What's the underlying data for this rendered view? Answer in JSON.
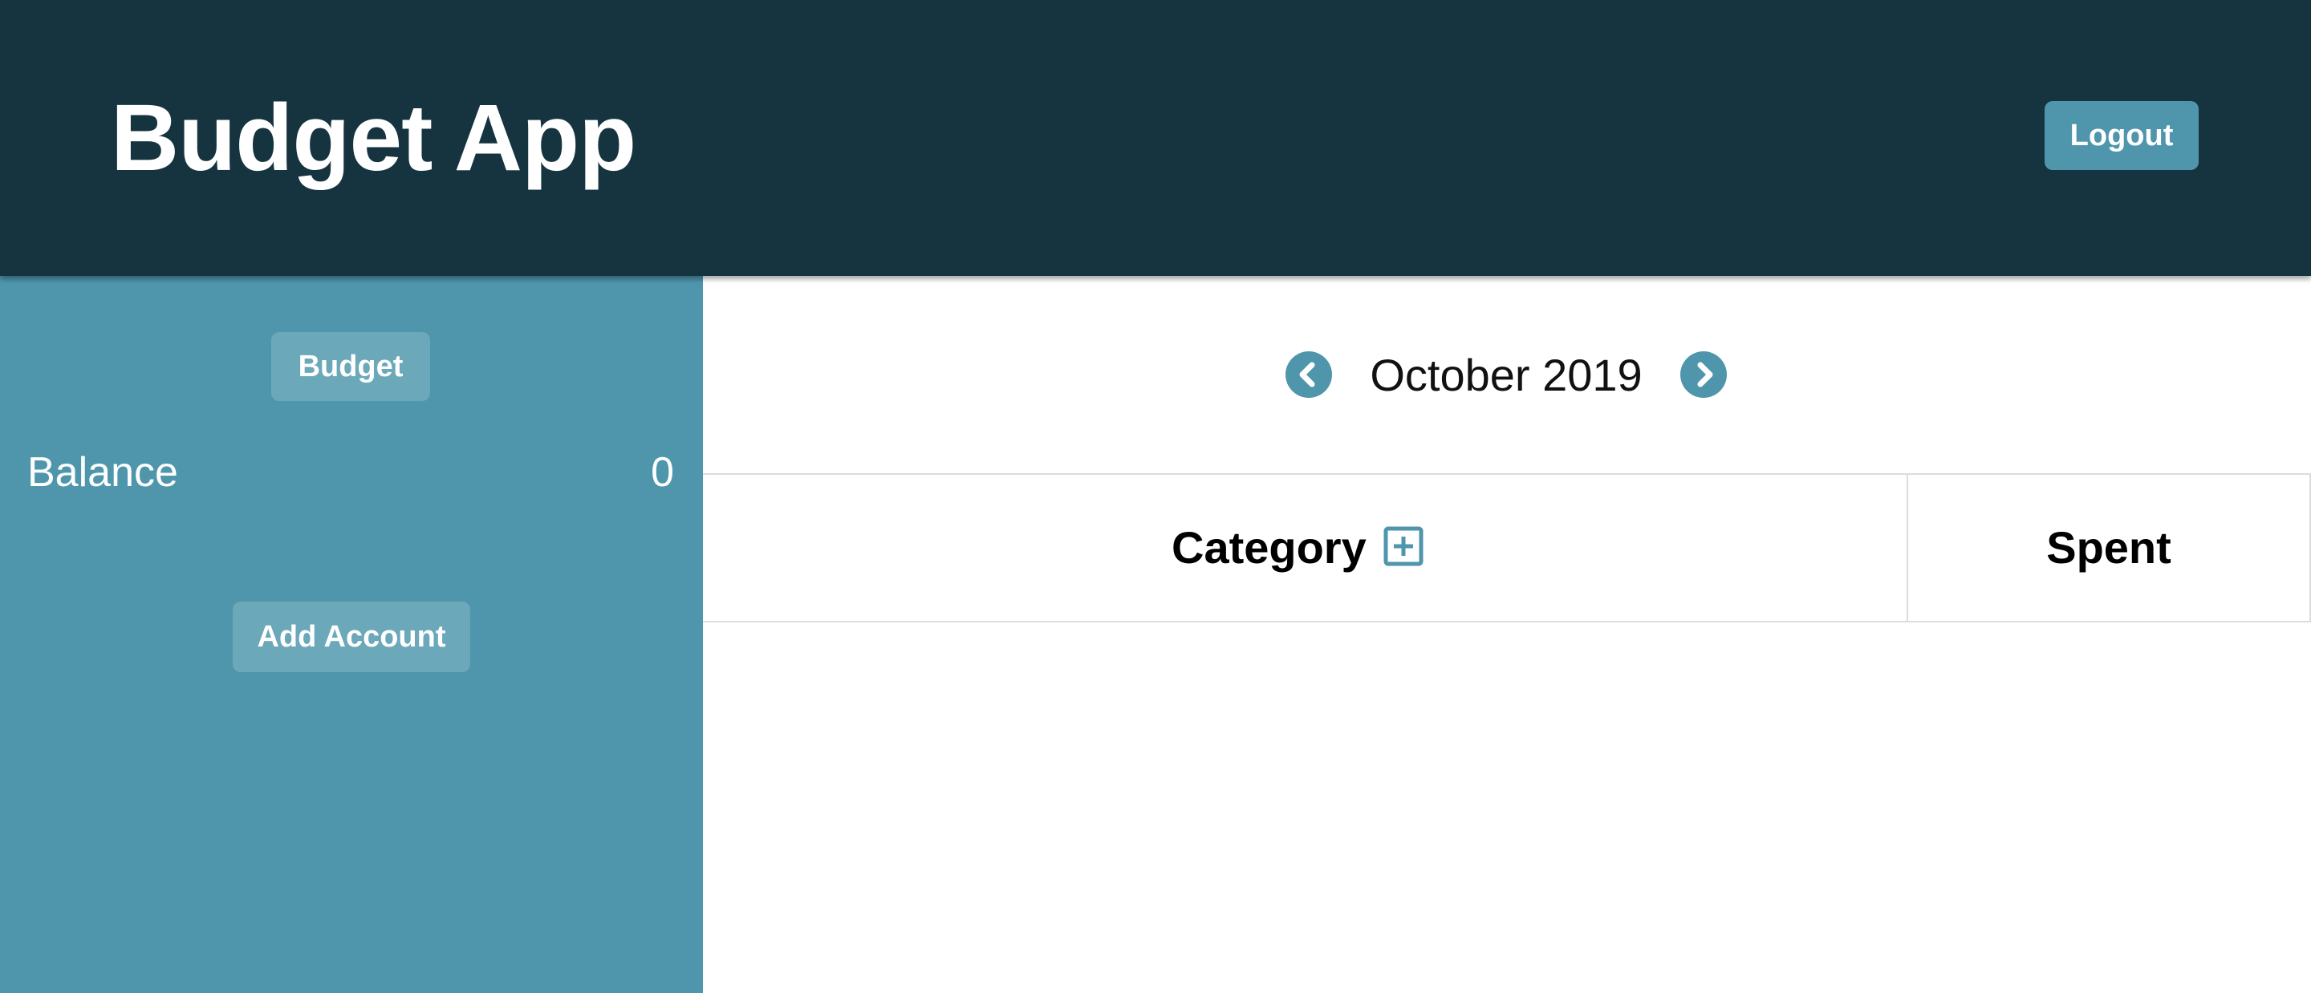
{
  "header": {
    "title": "Budget App",
    "logout_label": "Logout"
  },
  "sidebar": {
    "budget_label": "Budget",
    "balance_label": "Balance",
    "balance_value": "0",
    "add_account_label": "Add Account"
  },
  "month_nav": {
    "current_month": "October 2019",
    "prev_icon": "chevron-left-circle-icon",
    "next_icon": "chevron-right-circle-icon"
  },
  "table": {
    "columns": [
      "Category",
      "Spent"
    ],
    "add_category_icon": "plus-square-icon",
    "rows": []
  },
  "colors": {
    "header_bg": "#163440",
    "accent": "#4f96ac",
    "sidebar_button": "#6ba8ba"
  }
}
